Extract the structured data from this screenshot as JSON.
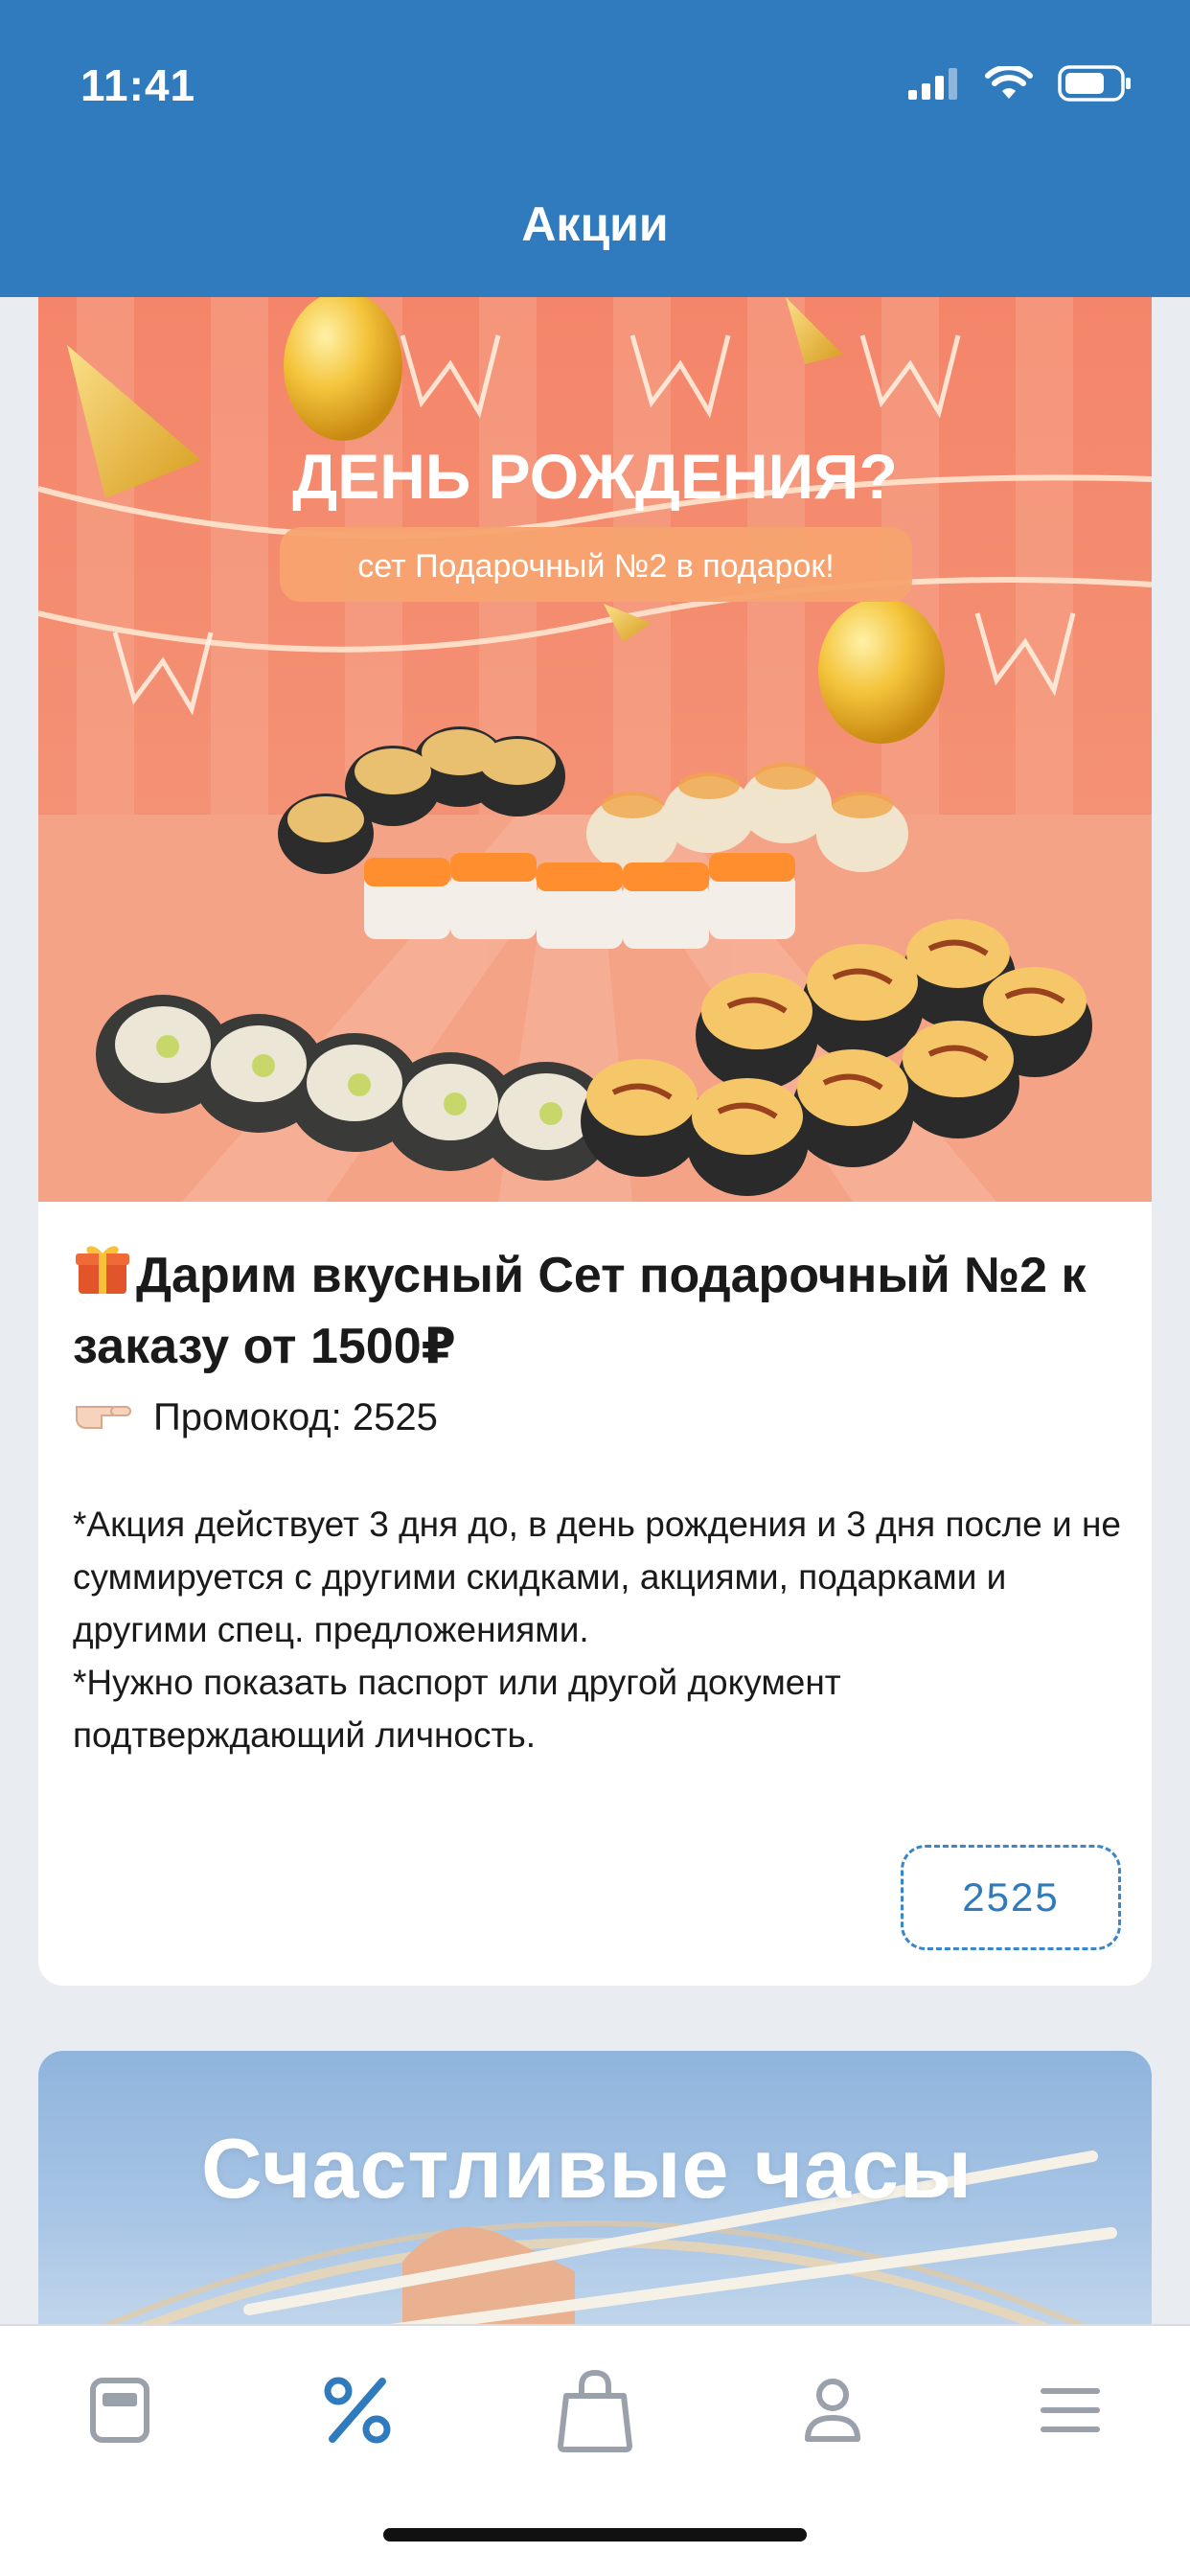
{
  "status_bar": {
    "time": "11:41"
  },
  "header": {
    "title": "Акции"
  },
  "promo": {
    "banner": {
      "headline": "ДЕНЬ РОЖДЕНИЯ?",
      "subline": "сет Подарочный №2 в подарок!"
    },
    "title_icon": "gift-icon",
    "title": "Дарим вкусный Сет подарочный №2 к заказу от 1500₽",
    "promo_code_icon": "pointing-hand-icon",
    "promo_code_label": "Промокод: 2525",
    "description": "*Акция действует 3 дня до, в день рождения и 3 дня после и не суммируется с другими скидками, акциями, подарками и другими спец. предложениями.\n*Нужно показать паспорт или другой документ подтверждающий личность.",
    "code_button": "2525"
  },
  "next_promo": {
    "banner_title": "Счастливые часы"
  },
  "tab_bar": {
    "items": [
      {
        "icon": "menu-card-icon",
        "active": false
      },
      {
        "icon": "percent-icon",
        "active": true
      },
      {
        "icon": "shopping-bag-icon",
        "active": false
      },
      {
        "icon": "profile-icon",
        "active": false
      },
      {
        "icon": "hamburger-menu-icon",
        "active": false
      }
    ]
  },
  "colors": {
    "primary": "#2f7bbd",
    "background": "#e9ecf1",
    "inactive_icon": "#9aa1ab"
  }
}
